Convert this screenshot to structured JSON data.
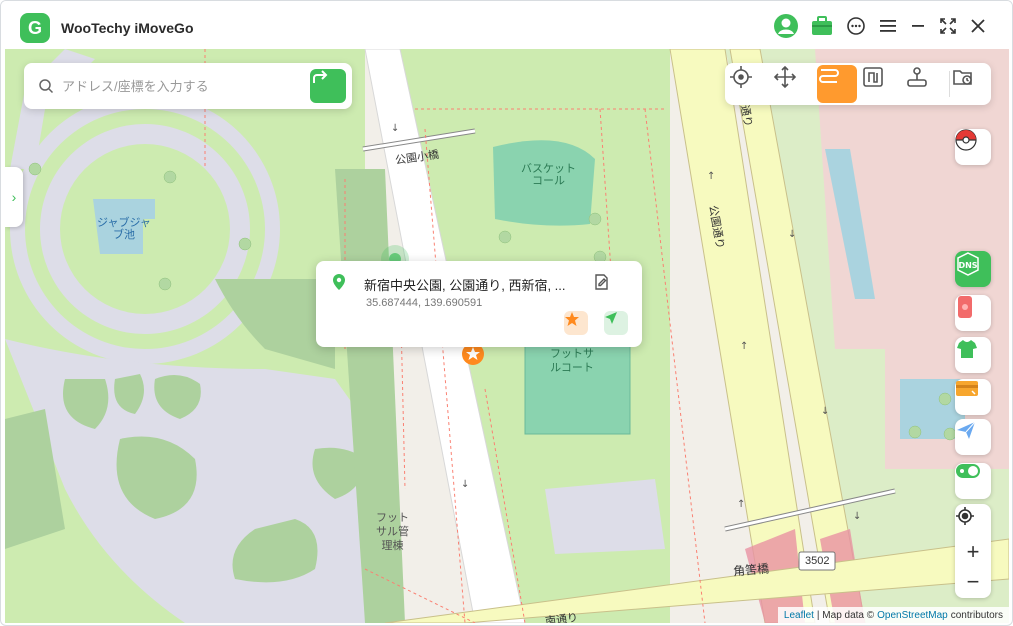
{
  "app": {
    "title": "WooTechy iMoveGo",
    "logo_letter": "G"
  },
  "titlebar_icons": [
    "user-avatar-icon",
    "toolbox-icon",
    "chat-icon",
    "menu-icon",
    "minimize-icon",
    "fullscreen-icon",
    "close-icon"
  ],
  "search": {
    "placeholder": "アドレス/座標を入力する",
    "value": ""
  },
  "mode_toolbar": {
    "modes": [
      "teleport-mode",
      "joystick-mode",
      "multi-spot-mode",
      "two-spot-mode",
      "jump-teleport-mode",
      "history-mode"
    ],
    "active": "multi-spot-mode",
    "accent": "#ff9a2e"
  },
  "right_tools": [
    "pokeball-icon",
    "dns-icon",
    "phone-icon",
    "clothing-icon",
    "card-icon",
    "send-icon",
    "toggle-icon"
  ],
  "zoom": {
    "plus": "+",
    "minus": "−"
  },
  "popup": {
    "place": "新宿中央公園, 公園通り, 西新宿, ...",
    "coords": "35.687444, 139.690591"
  },
  "map_labels": {
    "pond": "ジャブジャ\nブ池",
    "basketball": "バスケット\nコール",
    "futsal_court": "フットサ\nルコート",
    "futsal_office": "フット\nサル管\n理棟",
    "bridge": "公園小橋",
    "road1": "公園通り",
    "road2": "公園通り",
    "road3": "角筈橋",
    "road4": "南通り",
    "road_number": "3502"
  },
  "attribution": {
    "leaflet": "Leaflet",
    "map_data": "| Map data ©",
    "osm": "OpenStreetMap",
    "contributors": "contributors"
  },
  "colors": {
    "brand_green": "#3fbf5a",
    "park_green": "#cdebb0",
    "road_yellow": "#f7fabf"
  }
}
